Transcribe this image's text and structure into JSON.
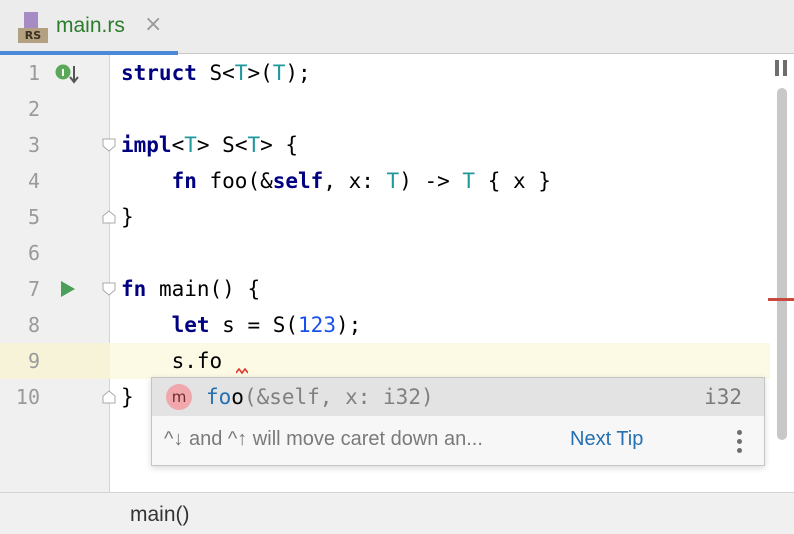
{
  "tab": {
    "icon_badge": "RS",
    "label": "main.rs",
    "close": "×"
  },
  "gutter": {
    "line_numbers": [
      "1",
      "2",
      "3",
      "4",
      "5",
      "6",
      "7",
      "8",
      "9",
      "10"
    ],
    "impl_icon_letter": "I"
  },
  "code": {
    "lines": [
      [
        {
          "t": "struct",
          "c": "kw"
        },
        {
          "t": " S<"
        },
        {
          "t": "T",
          "c": "tp"
        },
        {
          "t": ">("
        },
        {
          "t": "T",
          "c": "tp"
        },
        {
          "t": ");"
        }
      ],
      [],
      [
        {
          "t": "impl",
          "c": "kw"
        },
        {
          "t": "<"
        },
        {
          "t": "T",
          "c": "tp"
        },
        {
          "t": "> S<"
        },
        {
          "t": "T",
          "c": "tp"
        },
        {
          "t": "> {"
        }
      ],
      [
        {
          "t": "    "
        },
        {
          "t": "fn",
          "c": "kw"
        },
        {
          "t": " foo(&"
        },
        {
          "t": "self",
          "c": "kw"
        },
        {
          "t": ", x: "
        },
        {
          "t": "T",
          "c": "tp"
        },
        {
          "t": ") -> "
        },
        {
          "t": "T",
          "c": "tp"
        },
        {
          "t": " { x }"
        }
      ],
      [
        {
          "t": "}"
        }
      ],
      [],
      [
        {
          "t": "fn",
          "c": "kw"
        },
        {
          "t": " main() {"
        }
      ],
      [
        {
          "t": "    "
        },
        {
          "t": "let",
          "c": "kw"
        },
        {
          "t": " s = S("
        },
        {
          "t": "123",
          "c": "num"
        },
        {
          "t": ");"
        }
      ],
      [
        {
          "t": "    s.fo"
        }
      ],
      [
        {
          "t": "}"
        }
      ]
    ]
  },
  "completion": {
    "kind_icon": "m",
    "match": "fo",
    "rest": "o",
    "signature": "(&self, x: i32)",
    "type": "i32",
    "tip": "^↓ and ^↑ will move caret down an...",
    "next_tip_label": "Next Tip"
  },
  "breadcrumb": "main()",
  "colors": {
    "keyword": "#000080",
    "type_param": "#20999d",
    "number": "#1750eb",
    "match": "#2470b3",
    "tab_label": "#2a7d2a",
    "error": "#c8473f"
  }
}
